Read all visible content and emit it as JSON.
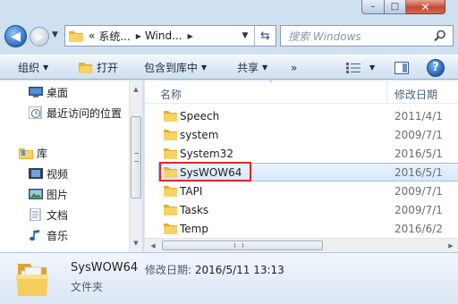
{
  "window": {
    "caption": {
      "minimize": "–",
      "maximize": "□",
      "close": "✕"
    }
  },
  "navigation": {
    "back_icon": "back-arrow-icon",
    "forward_icon": "forward-arrow-icon",
    "address": {
      "prefix": "«",
      "crumbs": [
        "系统...",
        "Wind..."
      ],
      "separator": "▶"
    },
    "search": {
      "placeholder": "搜索 Windows"
    }
  },
  "toolbar": {
    "organize": "组织",
    "open": "打开",
    "include_in_library": "包含到库中",
    "share": "共享",
    "more": "»"
  },
  "nav_pane": {
    "items": [
      {
        "label": "桌面",
        "icon": "desktop-icon"
      },
      {
        "label": "最近访问的位置",
        "icon": "recent-places-icon"
      },
      {
        "label": "库",
        "icon": "library-icon"
      },
      {
        "label": "视频",
        "icon": "video-icon"
      },
      {
        "label": "图片",
        "icon": "pictures-icon"
      },
      {
        "label": "文档",
        "icon": "documents-icon"
      },
      {
        "label": "音乐",
        "icon": "music-icon"
      }
    ]
  },
  "file_list": {
    "columns": {
      "name": "名称",
      "modified": "修改日期"
    },
    "rows": [
      {
        "name": "Speech",
        "date": "2011/4/1"
      },
      {
        "name": "system",
        "date": "2009/7/1"
      },
      {
        "name": "System32",
        "date": "2016/5/1"
      },
      {
        "name": "SysWOW64",
        "date": "2016/5/1",
        "selected": true
      },
      {
        "name": "TAPI",
        "date": "2009/7/1"
      },
      {
        "name": "Tasks",
        "date": "2009/7/1"
      },
      {
        "name": "Temp",
        "date": "2016/6/2"
      }
    ]
  },
  "details": {
    "name": "SysWOW64",
    "modified_label": "修改日期:",
    "modified_value": "2016/5/11 13:13",
    "type": "文件夹"
  },
  "colors": {
    "selection_border": "#e0262b",
    "folder": "#f4c64a",
    "chrome": "#cfe0f1"
  }
}
